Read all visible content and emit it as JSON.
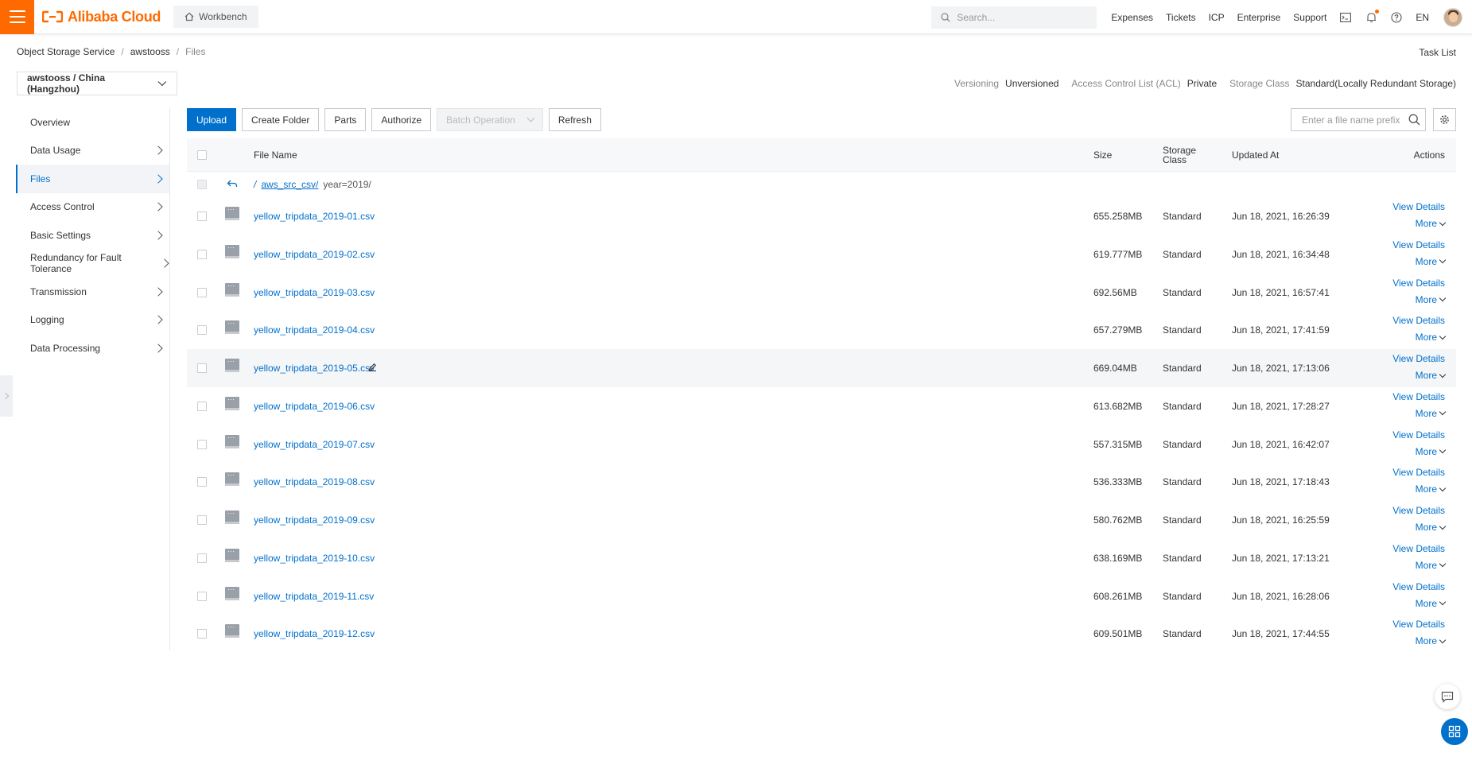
{
  "topbar": {
    "brand": "Alibaba Cloud",
    "workbench": "Workbench",
    "search_placeholder": "Search...",
    "links": [
      "Expenses",
      "Tickets",
      "ICP",
      "Enterprise",
      "Support"
    ],
    "lang": "EN",
    "accent_color": "#ff6a00"
  },
  "breadcrumb": {
    "items": [
      "Object Storage Service",
      "awstooss",
      "Files"
    ],
    "task_list": "Task List"
  },
  "bucket": {
    "selector": "awstooss / China (Hangzhou)",
    "meta": [
      {
        "label": "Versioning",
        "value": "Unversioned"
      },
      {
        "label": "Access Control List (ACL)",
        "value": "Private"
      },
      {
        "label": "Storage Class",
        "value": "Standard(Locally Redundant Storage)"
      }
    ]
  },
  "sidenav": {
    "items": [
      {
        "label": "Overview"
      },
      {
        "label": "Data Usage"
      },
      {
        "label": "Files"
      },
      {
        "label": "Access Control"
      },
      {
        "label": "Basic Settings"
      },
      {
        "label": "Redundancy for Fault Tolerance"
      },
      {
        "label": "Transmission"
      },
      {
        "label": "Logging"
      },
      {
        "label": "Data Processing"
      }
    ],
    "active": "Files"
  },
  "toolbar": {
    "upload": "Upload",
    "create_folder": "Create Folder",
    "parts": "Parts",
    "authorize": "Authorize",
    "batch_operation": "Batch Operation",
    "refresh": "Refresh",
    "filter_placeholder": "Enter a file name prefix"
  },
  "table": {
    "headers": {
      "name": "File Name",
      "size": "Size",
      "storage_class_1": "Storage",
      "storage_class_2": "Class",
      "updated": "Updated At",
      "actions": "Actions"
    },
    "path": {
      "root": "/",
      "folder": "aws_src_csv/",
      "current": "year=2019/"
    },
    "view_details": "View Details",
    "more": "More",
    "rows": [
      {
        "name": "yellow_tripdata_2019-01.csv",
        "size": "655.258MB",
        "class": "Standard",
        "updated": "Jun 18, 2021, 16:26:39"
      },
      {
        "name": "yellow_tripdata_2019-02.csv",
        "size": "619.777MB",
        "class": "Standard",
        "updated": "Jun 18, 2021, 16:34:48"
      },
      {
        "name": "yellow_tripdata_2019-03.csv",
        "size": "692.56MB",
        "class": "Standard",
        "updated": "Jun 18, 2021, 16:57:41"
      },
      {
        "name": "yellow_tripdata_2019-04.csv",
        "size": "657.279MB",
        "class": "Standard",
        "updated": "Jun 18, 2021, 17:41:59"
      },
      {
        "name": "yellow_tripdata_2019-05.csv",
        "size": "669.04MB",
        "class": "Standard",
        "updated": "Jun 18, 2021, 17:13:06"
      },
      {
        "name": "yellow_tripdata_2019-06.csv",
        "size": "613.682MB",
        "class": "Standard",
        "updated": "Jun 18, 2021, 17:28:27"
      },
      {
        "name": "yellow_tripdata_2019-07.csv",
        "size": "557.315MB",
        "class": "Standard",
        "updated": "Jun 18, 2021, 16:42:07"
      },
      {
        "name": "yellow_tripdata_2019-08.csv",
        "size": "536.333MB",
        "class": "Standard",
        "updated": "Jun 18, 2021, 17:18:43"
      },
      {
        "name": "yellow_tripdata_2019-09.csv",
        "size": "580.762MB",
        "class": "Standard",
        "updated": "Jun 18, 2021, 16:25:59"
      },
      {
        "name": "yellow_tripdata_2019-10.csv",
        "size": "638.169MB",
        "class": "Standard",
        "updated": "Jun 18, 2021, 17:13:21"
      },
      {
        "name": "yellow_tripdata_2019-11.csv",
        "size": "608.261MB",
        "class": "Standard",
        "updated": "Jun 18, 2021, 16:28:06"
      },
      {
        "name": "yellow_tripdata_2019-12.csv",
        "size": "609.501MB",
        "class": "Standard",
        "updated": "Jun 18, 2021, 17:44:55"
      }
    ]
  }
}
